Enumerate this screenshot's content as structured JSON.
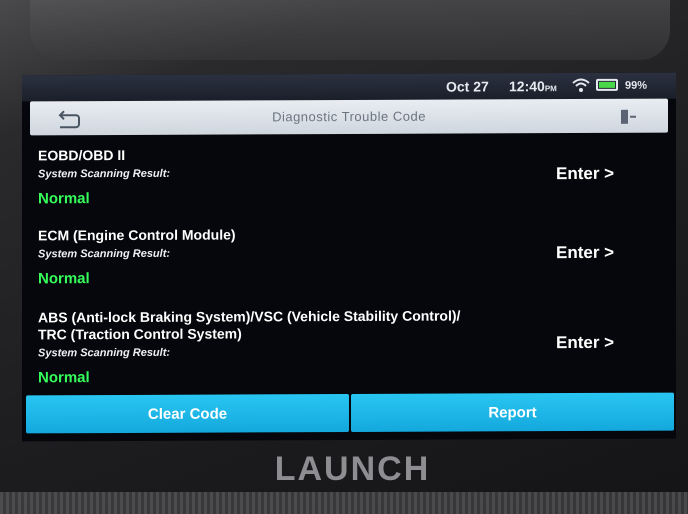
{
  "status_bar": {
    "date": "Oct 27",
    "time": "12:40",
    "ampm": "PM",
    "battery": "99%"
  },
  "title_bar": {
    "title": "Diagnostic Trouble Code",
    "back_icon": "back-arrow-icon",
    "exit_icon": "exit-icon"
  },
  "systems": [
    {
      "name": "EOBD/OBD II",
      "result_label": "System Scanning Result:",
      "result": "Normal",
      "action": "Enter >"
    },
    {
      "name": "ECM (Engine Control Module)",
      "result_label": "System Scanning Result:",
      "result": "Normal",
      "action": "Enter >"
    },
    {
      "name_line1": "ABS (Anti-lock Braking System)/VSC (Vehicle Stability Control)/",
      "name_line2": "TRC (Traction Control System)",
      "result_label": "System Scanning Result:",
      "result": "Normal",
      "action": "Enter >"
    }
  ],
  "bottom_bar": {
    "clear_code": "Clear Code",
    "report": "Report"
  },
  "device": {
    "brand": "LAUNCH"
  },
  "colors": {
    "accent": "#1fb6ea",
    "normal_status": "#35ff5a"
  }
}
